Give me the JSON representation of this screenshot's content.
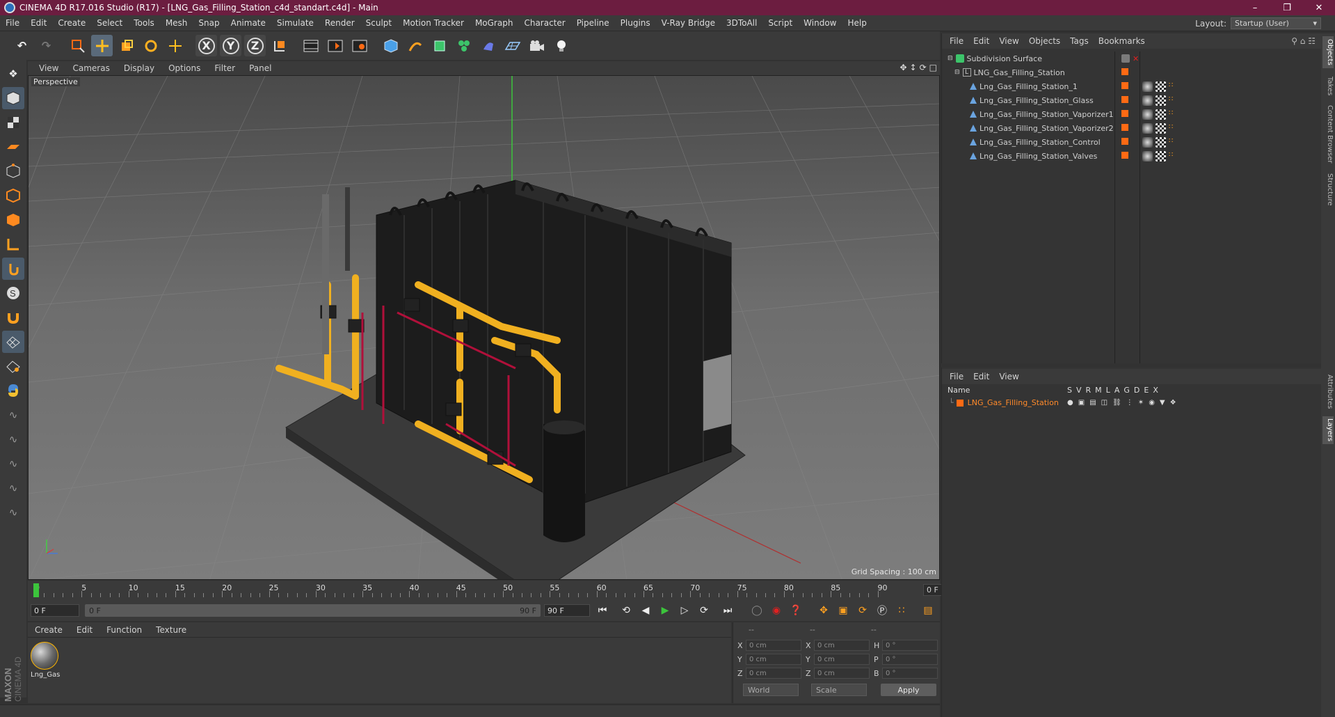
{
  "window": {
    "title": "CINEMA 4D R17.016 Studio (R17) - [LNG_Gas_Filling_Station_c4d_standart.c4d] - Main"
  },
  "menu": [
    "File",
    "Edit",
    "Create",
    "Select",
    "Tools",
    "Mesh",
    "Snap",
    "Animate",
    "Simulate",
    "Render",
    "Sculpt",
    "Motion Tracker",
    "MoGraph",
    "Character",
    "Pipeline",
    "Plugins",
    "V-Ray Bridge",
    "3DToAll",
    "Script",
    "Window",
    "Help"
  ],
  "layout": {
    "label": "Layout:",
    "value": "Startup (User)"
  },
  "toolbar": {
    "axis_x": "X",
    "axis_y": "Y",
    "axis_z": "Z"
  },
  "viewport": {
    "menu": [
      "View",
      "Cameras",
      "Display",
      "Options",
      "Filter",
      "Panel"
    ],
    "label": "Perspective",
    "grid_spacing": "Grid Spacing : 100 cm"
  },
  "timeline": {
    "ticks": [
      "0",
      "5",
      "10",
      "15",
      "20",
      "25",
      "30",
      "35",
      "40",
      "45",
      "50",
      "55",
      "60",
      "65",
      "70",
      "75",
      "80",
      "85",
      "90"
    ],
    "end_field": "0 F",
    "start_field": "0 F",
    "range_start": "0 F",
    "range_end": "90 F",
    "end_frame": "90 F"
  },
  "materials": {
    "menu": [
      "Create",
      "Edit",
      "Function",
      "Texture"
    ],
    "items": [
      {
        "name": "Lng_Gas"
      }
    ]
  },
  "coords": {
    "headers": [
      "--",
      "--",
      "--"
    ],
    "rows": [
      {
        "a": "X",
        "av": "0 cm",
        "b": "X",
        "bv": "0 cm",
        "c": "H",
        "cv": "0 °"
      },
      {
        "a": "Y",
        "av": "0 cm",
        "b": "Y",
        "bv": "0 cm",
        "c": "P",
        "cv": "0 °"
      },
      {
        "a": "Z",
        "av": "0 cm",
        "b": "Z",
        "bv": "0 cm",
        "c": "B",
        "cv": "0 °"
      }
    ],
    "world": "World",
    "scale": "Scale",
    "apply": "Apply"
  },
  "objects": {
    "menu": [
      "File",
      "Edit",
      "View",
      "Objects",
      "Tags",
      "Bookmarks"
    ],
    "tree": [
      {
        "name": "Subdivision Surface",
        "indent": 0
      },
      {
        "name": "LNG_Gas_Filling_Station",
        "indent": 1
      },
      {
        "name": "Lng_Gas_Filling_Station_1",
        "indent": 2
      },
      {
        "name": "Lng_Gas_Filling_Station_Glass",
        "indent": 2
      },
      {
        "name": "Lng_Gas_Filling_Station_Vaporizer1",
        "indent": 2
      },
      {
        "name": "Lng_Gas_Filling_Station_Vaporizer2",
        "indent": 2
      },
      {
        "name": "Lng_Gas_Filling_Station_Control",
        "indent": 2
      },
      {
        "name": "Lng_Gas_Filling_Station_Valves",
        "indent": 2
      }
    ]
  },
  "layers": {
    "menu": [
      "File",
      "Edit",
      "View"
    ],
    "header_name": "Name",
    "columns": [
      "S",
      "V",
      "R",
      "M",
      "L",
      "A",
      "G",
      "D",
      "E",
      "X"
    ],
    "rows": [
      {
        "name": "LNG_Gas_Filling_Station"
      }
    ]
  },
  "side_tabs": [
    "Objects",
    "Takes",
    "Content Browser",
    "Structure"
  ],
  "side_tabs2": [
    "Attributes",
    "Layers"
  ],
  "brand": "MAXON CINEMA 4D",
  "colors": {
    "titlebar": "#6c1d40",
    "accent_orange": "#ff6a14",
    "yellow_pipes": "#f0b020"
  }
}
